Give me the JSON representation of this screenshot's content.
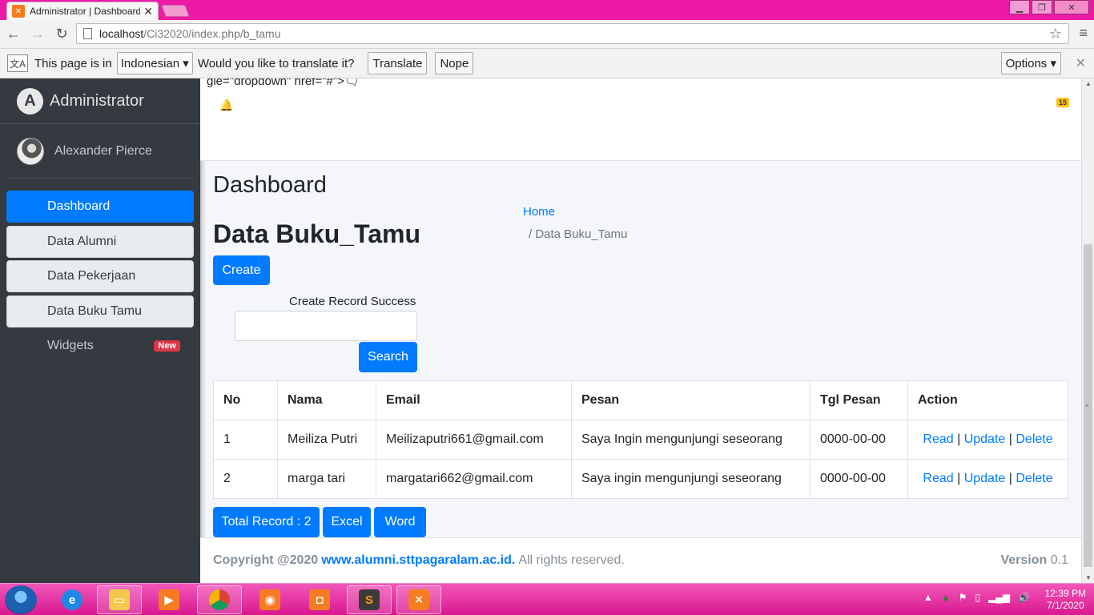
{
  "browser": {
    "tab_title": "Administrator | Dashboard",
    "tab_close": "✕",
    "url_host": "localhost",
    "url_path": "/Ci32020/index.php/b_tamu",
    "star": "☆",
    "menu": "≡"
  },
  "translate_bar": {
    "prefix": "This page is in",
    "language": "Indonesian ▾",
    "question": "Would you like to translate it?",
    "translate_btn": "Translate",
    "nope_btn": "Nope",
    "options_btn": "Options ▾",
    "close": "✕"
  },
  "sidebar": {
    "brand": "Administrator",
    "brand_logo": "A",
    "user": "Alexander Pierce",
    "items": [
      {
        "label": "Dashboard",
        "state": "active"
      },
      {
        "label": "Data Alumni",
        "state": "normal"
      },
      {
        "label": "Data Pekerjaan",
        "state": "normal"
      },
      {
        "label": "Data Buku Tamu",
        "state": "normal"
      },
      {
        "label": "Widgets",
        "state": "plain",
        "badge": "New"
      }
    ]
  },
  "navbar": {
    "raw_text": "gle=\"dropdown\" href=\"#\">🗨",
    "bell": "🔔",
    "notif_count": "15"
  },
  "main": {
    "heading": "Dashboard",
    "breadcrumb_home": "Home",
    "breadcrumb_current": "/  Data Buku_Tamu",
    "subheading": "Data Buku_Tamu",
    "create_btn": "Create",
    "message": "Create Record Success",
    "search_value": "",
    "search_btn": "Search",
    "table": {
      "headers": [
        "No",
        "Nama",
        "Email",
        "Pesan",
        "Tgl Pesan",
        "Action"
      ],
      "rows": [
        {
          "no": "1",
          "nama": "Meiliza Putri",
          "email": "Meilizaputri661@gmail.com",
          "pesan": "Saya Ingin mengunjungi seseorang",
          "tgl": "0000-00-00"
        },
        {
          "no": "2",
          "nama": "marga tari",
          "email": "margatari662@gmail.com",
          "pesan": "Saya ingin mengunjungi seseorang",
          "tgl": "0000-00-00"
        }
      ],
      "actions": {
        "read": "Read",
        "update": "Update",
        "delete": "Delete",
        "sep": "|"
      }
    },
    "total_btn": "Total Record : 2",
    "excel_btn": "Excel",
    "word_btn": "Word"
  },
  "footer": {
    "copyright": "Copyright @2020",
    "link": "www.alumni.sttpagaralam.ac.id.",
    "rights": "All rights reserved.",
    "version_label": "Version",
    "version_value": "0.1"
  },
  "taskbar": {
    "time": "12:39 PM",
    "date": "7/1/2020"
  },
  "colors": {
    "primary": "#007bff",
    "sidebar": "#343a40",
    "danger": "#dc3545",
    "warning": "#ffc107",
    "desktop": "#ec1aa6"
  }
}
